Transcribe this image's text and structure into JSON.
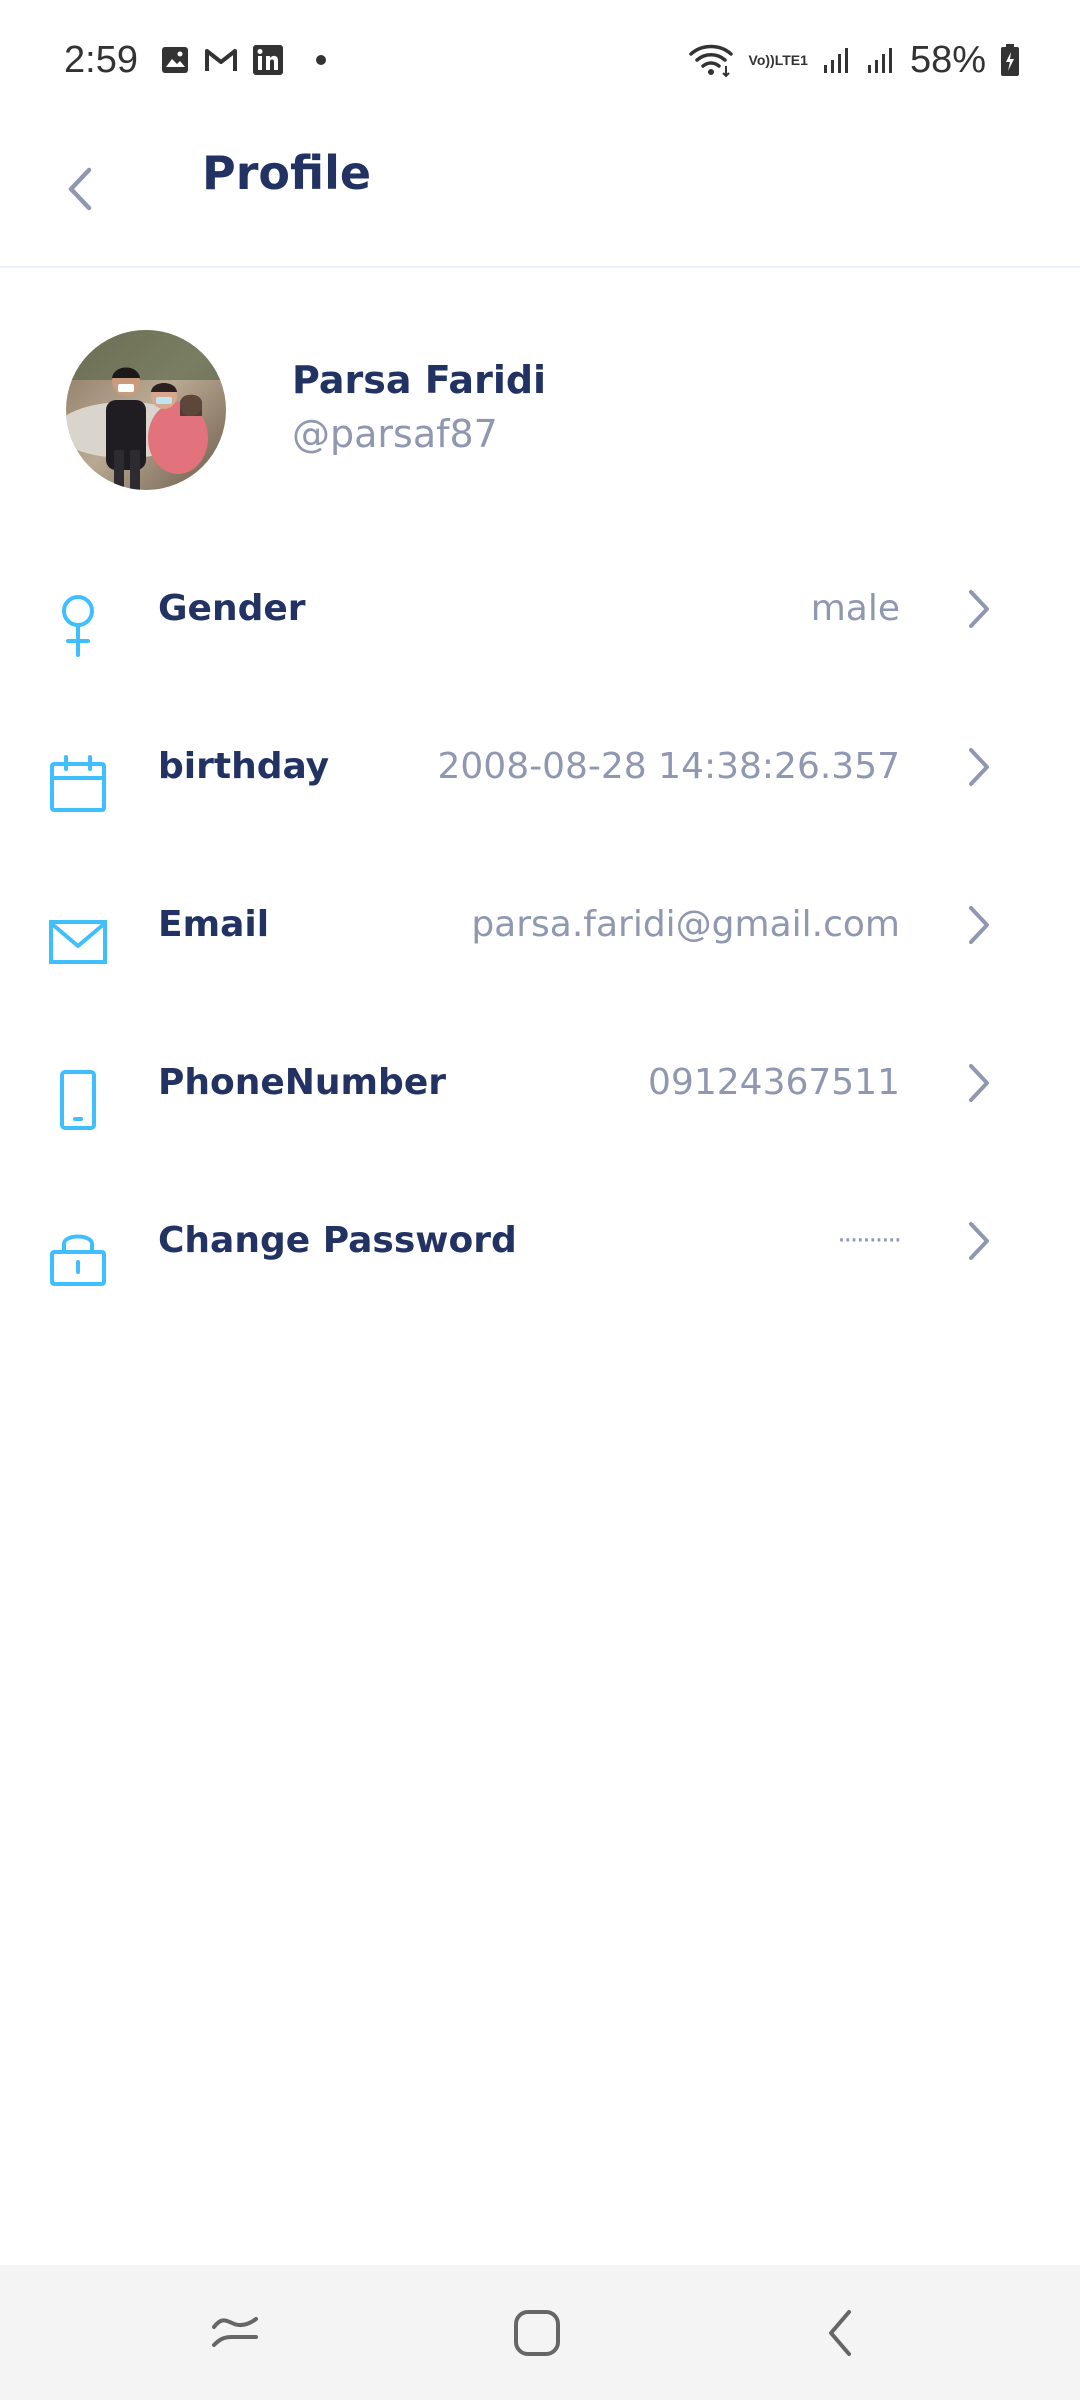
{
  "status_bar": {
    "time": "2:59",
    "battery_percent": "58%",
    "network_label_top": "Vo))",
    "network_label_bottom": "LTE1",
    "icons": [
      "gallery-icon",
      "gmail-icon",
      "linkedin-icon",
      "notification-dot",
      "wifi-icon",
      "volte-icon",
      "signal-icon",
      "signal-icon",
      "battery-icon"
    ]
  },
  "header": {
    "title": "Profile",
    "back_icon": "chevron-left-icon"
  },
  "profile": {
    "name": "Parsa Faridi",
    "handle": "@parsaf87"
  },
  "fields": [
    {
      "key": "gender",
      "icon": "female-symbol-icon",
      "label": "Gender",
      "value": "male"
    },
    {
      "key": "birthday",
      "icon": "calendar-icon",
      "label": "birthday",
      "value": "2008-08-28 14:38:26.357"
    },
    {
      "key": "email",
      "icon": "mail-icon",
      "label": "Email",
      "value": "parsa.faridi@gmail.com"
    },
    {
      "key": "phone",
      "icon": "smartphone-icon",
      "label": "PhoneNumber",
      "value": "09124367511"
    },
    {
      "key": "password",
      "icon": "lock-icon",
      "label": "Change Password",
      "value": "··········"
    }
  ],
  "colors": {
    "primary_text": "#223263",
    "secondary_text": "#9098b1",
    "icon_accent": "#40bfff",
    "divider": "#ebf0ff",
    "nav_background": "#f4f4f4"
  },
  "nav_bar": {
    "buttons": [
      "recent-apps-icon",
      "home-icon",
      "back-icon"
    ]
  }
}
